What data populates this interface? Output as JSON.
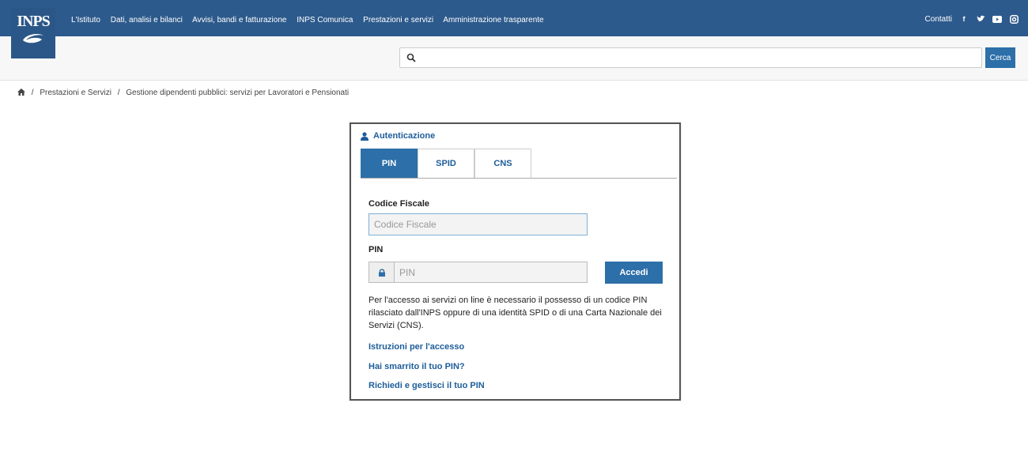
{
  "header": {
    "logo_text": "INPS",
    "nav": [
      "L'Istituto",
      "Dati, analisi e bilanci",
      "Avvisi, bandi e fatturazione",
      "INPS Comunica",
      "Prestazioni e servizi",
      "Amministrazione trasparente"
    ],
    "contacts_label": "Contatti",
    "social_icons": [
      "facebook-icon",
      "twitter-icon",
      "youtube-icon",
      "instagram-icon"
    ]
  },
  "search": {
    "placeholder": "",
    "button_label": "Cerca"
  },
  "breadcrumb": {
    "home_icon": "home-icon",
    "items": [
      "Prestazioni e Servizi",
      "Gestione dipendenti pubblici: servizi per Lavoratori e Pensionati"
    ]
  },
  "auth": {
    "title": "Autenticazione",
    "tabs": [
      "PIN",
      "SPID",
      "CNS"
    ],
    "active_tab": "PIN",
    "codice_fiscale_label": "Codice Fiscale",
    "codice_fiscale_placeholder": "Codice Fiscale",
    "pin_label": "PIN",
    "pin_placeholder": "PIN",
    "submit_label": "Accedi",
    "info_text": "Per l'accesso ai servizi on line è necessario il possesso di un codice PIN rilasciato dall'INPS oppure di una identità SPID o di una Carta Nazionale dei Servizi (CNS).",
    "links": [
      "Istruzioni per l'accesso",
      "Hai smarrito il tuo PIN?",
      "Richiedi e gestisci il tuo PIN"
    ]
  },
  "colors": {
    "brand": "#2d5a8c",
    "accent": "#2d6fa8",
    "link": "#1d5d99"
  }
}
